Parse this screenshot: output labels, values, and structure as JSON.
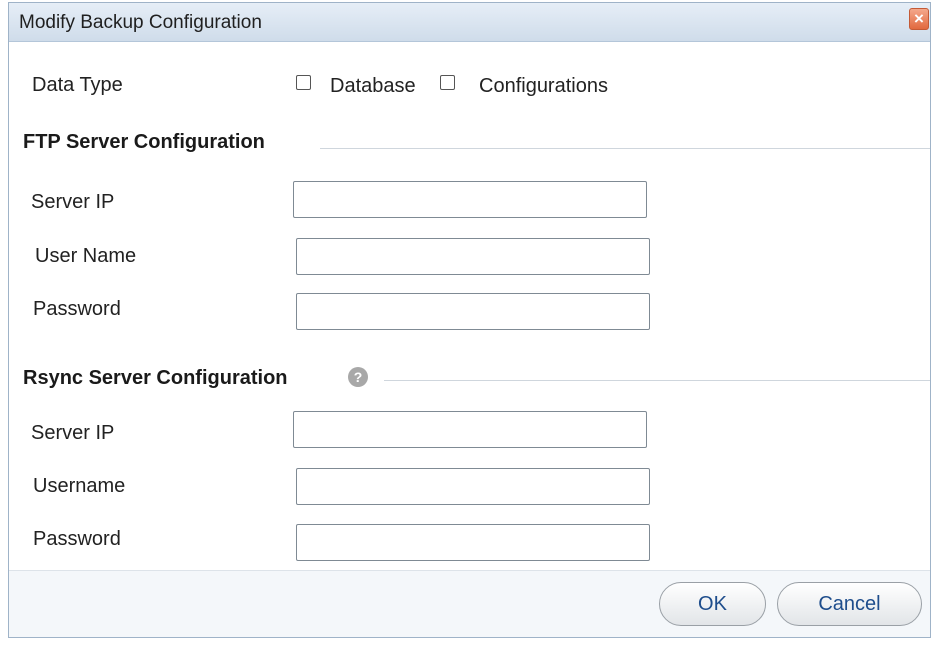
{
  "dialog": {
    "title": "Modify Backup Configuration",
    "close_glyph": "×"
  },
  "data_type": {
    "label": "Data Type",
    "options": [
      {
        "label": "Database",
        "checked": false
      },
      {
        "label": "Configurations",
        "checked": false
      }
    ]
  },
  "ftp": {
    "section_title": "FTP Server Configuration",
    "server_ip_label": "Server IP",
    "server_ip_value": "",
    "username_label": "User Name",
    "username_value": "",
    "password_label": "Password",
    "password_value": ""
  },
  "rsync": {
    "section_title": "Rsync Server Configuration",
    "help_glyph": "?",
    "server_ip_label": "Server IP",
    "server_ip_value": "",
    "username_label": "Username",
    "username_value": "",
    "password_label": "Password",
    "password_value": ""
  },
  "buttons": {
    "ok_label": "OK",
    "cancel_label": "Cancel"
  },
  "colors": {
    "title_bar": "#cfdcea",
    "close_button": "#e2693f",
    "button_text": "#1e4d8c"
  }
}
